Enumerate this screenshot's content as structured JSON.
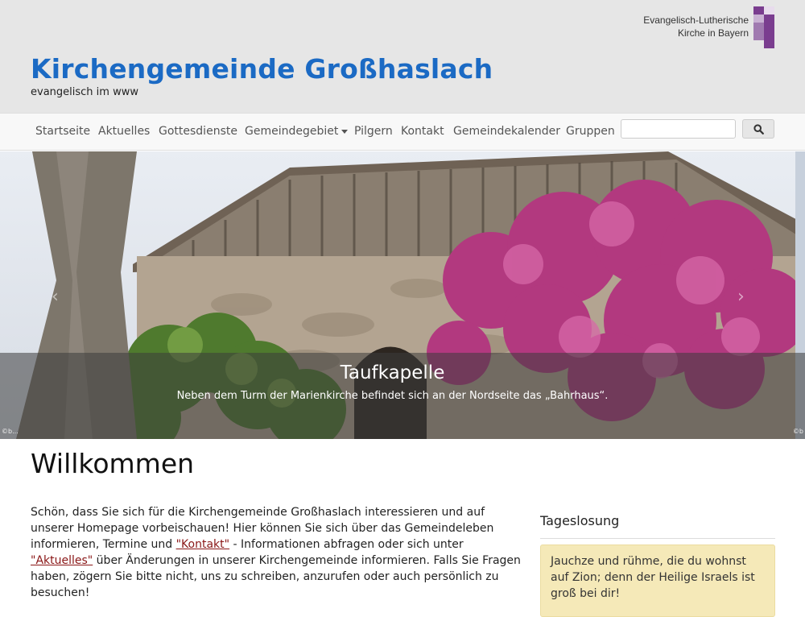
{
  "header": {
    "title": "Kirchengemeinde Großhaslach",
    "subtitle": "evangelisch im www",
    "logo_line1": "Evangelisch-Lutherische",
    "logo_line2": "Kirche in Bayern"
  },
  "nav": {
    "items": [
      {
        "label": "Startseite"
      },
      {
        "label": "Aktuelles"
      },
      {
        "label": "Gottesdienste"
      },
      {
        "label": "Gemeindegebiet"
      },
      {
        "label": "Pilgern"
      },
      {
        "label": "Kontakt"
      },
      {
        "label": "Gemeindekalender"
      },
      {
        "label": "Gruppen"
      }
    ],
    "search_placeholder": ""
  },
  "carousel": {
    "caption_title": "Taufkapelle",
    "caption_text": "Neben dem Turm der Marienkirche befindet sich an der Nordseite das „Bahrhaus“.",
    "prev": "‹",
    "next": "›",
    "credit_left": "©b...",
    "credit_right": "©b"
  },
  "main": {
    "heading": "Willkommen",
    "intro_part1": "Schön, dass Sie sich für die Kirchengemeinde Großhaslach interessieren und auf unserer Homepage vorbeischauen! Hier können Sie sich über das Gemeindeleben informieren, Termine und ",
    "link_kontakt": "\"Kontakt\"",
    "intro_part2": " - Informationen abfragen oder sich unter ",
    "link_aktuelles": "\"Aktuelles\"",
    "intro_part3": " über Änderungen in unserer Kirchengemeinde informieren. Falls Sie Fragen haben, zögern Sie bitte nicht, uns zu schreiben, anzurufen oder auch persönlich zu besuchen!"
  },
  "sidebar": {
    "title": "Tageslosung",
    "losung_text": "Jauchze und rühme, die du wohnst auf Zion; denn der Heilige Israels ist groß bei dir!"
  },
  "colors": {
    "brand_blue": "#1b6ac4",
    "link_red": "#8a1717",
    "losung_bg": "#f5e9b8",
    "logo_purple": "#7a3d8f"
  }
}
